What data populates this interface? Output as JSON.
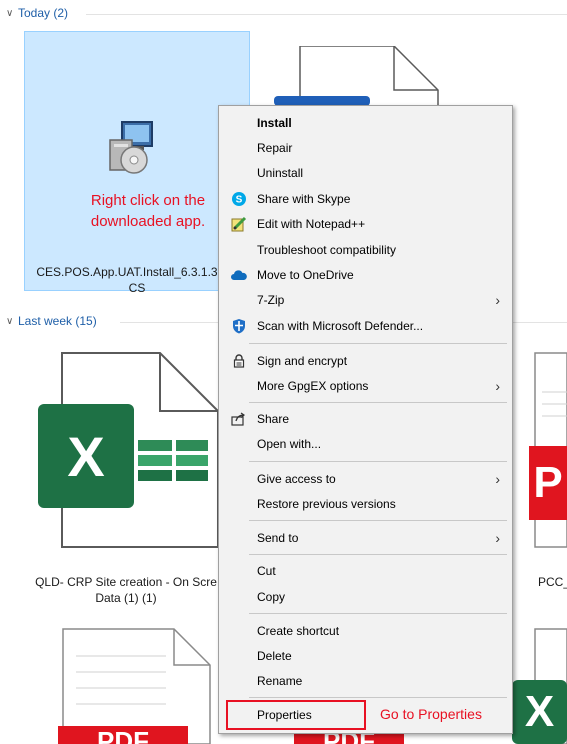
{
  "groups": {
    "today": "Today (2)",
    "last_week": "Last week (15)"
  },
  "files": {
    "installer_name_line1": "CES.POS.App.UAT.Install_6.3.1.331_",
    "installer_name_line2": "CS",
    "excel_name_line1": "QLD- CRP Site creation - On Scre",
    "excel_name_line2": "Data (1) (1)",
    "pcc_name": "PCC_",
    "excel_badge": "X",
    "pdf_badge": "P",
    "pdf_bottom_badge": "PDF"
  },
  "annotations": {
    "right_click_line1": "Right click on the",
    "right_click_line2": "downloaded app.",
    "go_to_properties": "Go to Properties"
  },
  "context_menu": {
    "install": "Install",
    "repair": "Repair",
    "uninstall": "Uninstall",
    "share_skype": "Share with Skype",
    "edit_notepad": "Edit with Notepad++",
    "troubleshoot": "Troubleshoot compatibility",
    "onedrive": "Move to OneDrive",
    "zip": "7-Zip",
    "defender": "Scan with Microsoft Defender...",
    "sign_encrypt": "Sign and encrypt",
    "gpgex": "More GpgEX options",
    "share": "Share",
    "open_with": "Open with...",
    "give_access": "Give access to",
    "restore": "Restore previous versions",
    "send_to": "Send to",
    "cut": "Cut",
    "copy": "Copy",
    "create_shortcut": "Create shortcut",
    "delete": "Delete",
    "rename": "Rename",
    "properties": "Properties"
  },
  "colors": {
    "accent": "#1f5fa8",
    "annotation_red": "#e81123",
    "selection": "#cce8ff",
    "excel_green": "#1e7145",
    "pdf_red": "#e0151f"
  }
}
